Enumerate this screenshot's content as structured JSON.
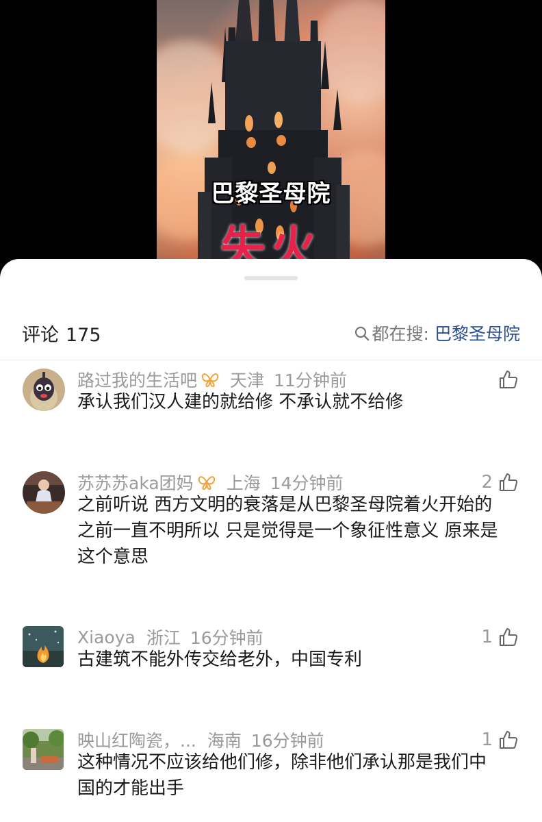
{
  "video": {
    "title": "巴黎圣母院",
    "subtitle": "失火"
  },
  "header": {
    "comments_label": "评论",
    "comments_count": "175",
    "search_prefix": "都在搜:",
    "search_term": "巴黎圣母院"
  },
  "comments": [
    {
      "username": "路过我的生活吧",
      "location": "天津",
      "time": "11分钟前",
      "likes": "",
      "text_lines": [
        "承认我们汉人建的就给修 不承认就不给修"
      ],
      "avatar_icon": "cartoon-avatar"
    },
    {
      "username": "苏苏苏aka团妈",
      "location": "上海",
      "time": "14分钟前",
      "likes": "2",
      "text_lines": [
        "之前听说 西方文明的衰落是从巴黎圣母院着火开始的",
        "之前一直不明所以 只是觉得是一个象征性意义 原来是",
        "这个意思"
      ],
      "avatar_icon": "photo-avatar"
    },
    {
      "username": "Xiaoya",
      "location": "浙江",
      "time": "16分钟前",
      "likes": "1",
      "text_lines": [
        "古建筑不能外传交给老外，中国专利"
      ],
      "avatar_icon": "fire-avatar"
    },
    {
      "username": "映山红陶瓷，...",
      "location": "海南",
      "time": "16分钟前",
      "likes": "1",
      "text_lines": [
        "这种情况不应该给他们修，除非他们承认那是我们中",
        "国的才能出手"
      ],
      "avatar_icon": "outdoor-avatar"
    }
  ],
  "colors": {
    "accent_link": "#2b4f8f",
    "badge": "#f2a23a",
    "subtitle_red": "#e8204a"
  }
}
